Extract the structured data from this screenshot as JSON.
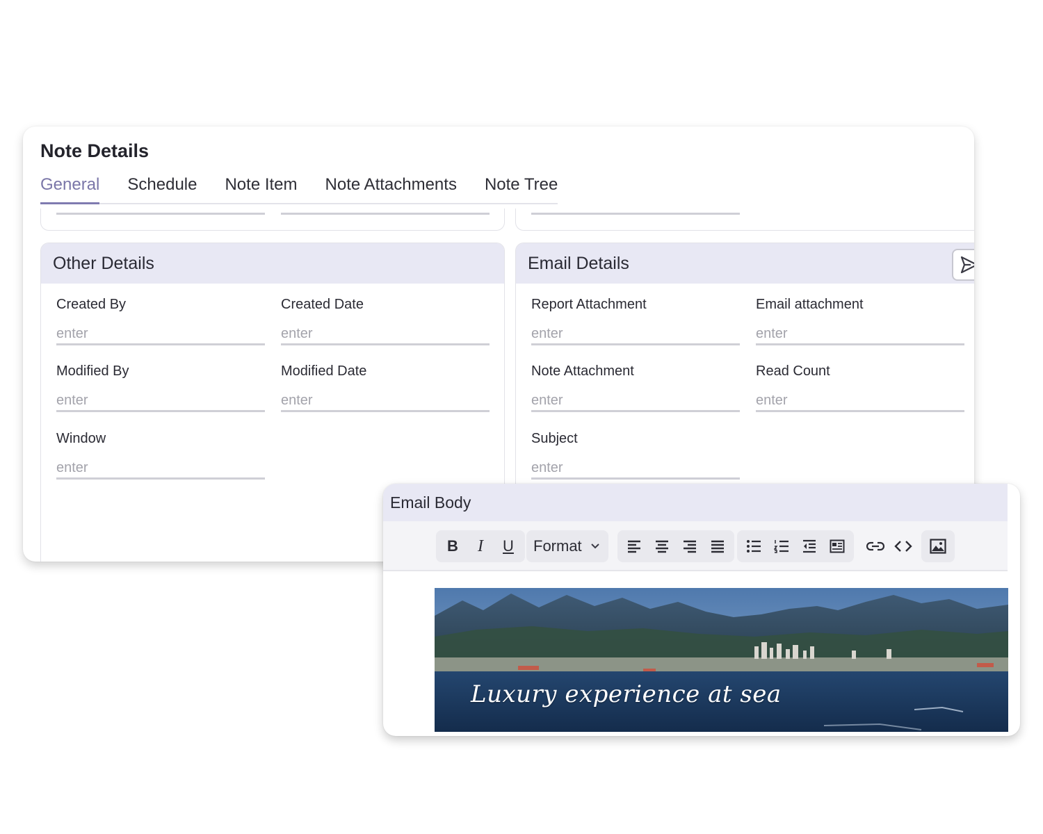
{
  "page_title": "Note Details",
  "tabs": [
    {
      "label": "General",
      "active": true
    },
    {
      "label": "Schedule",
      "active": false
    },
    {
      "label": "Note Item",
      "active": false
    },
    {
      "label": "Note Attachments",
      "active": false
    },
    {
      "label": "Note Tree",
      "active": false
    }
  ],
  "other_details": {
    "title": "Other Details",
    "fields": [
      {
        "label": "Created By",
        "placeholder": "enter"
      },
      {
        "label": "Created Date",
        "placeholder": "enter"
      },
      {
        "label": "Modified By",
        "placeholder": "enter"
      },
      {
        "label": "Modified Date",
        "placeholder": "enter"
      },
      {
        "label": "Window",
        "placeholder": "enter"
      }
    ]
  },
  "email_details": {
    "title": "Email Details",
    "send_icon": "send-icon",
    "fields": [
      {
        "label": "Report Attachment",
        "placeholder": "enter"
      },
      {
        "label": "Email attachment",
        "placeholder": "enter"
      },
      {
        "label": "Note Attachment",
        "placeholder": "enter"
      },
      {
        "label": "Read Count",
        "placeholder": "enter"
      },
      {
        "label": "Subject",
        "placeholder": "enter"
      }
    ]
  },
  "email_body": {
    "title": "Email Body",
    "toolbar": {
      "bold": "B",
      "italic": "I",
      "underline": "U",
      "format_label": "Format",
      "icons": [
        "align-left-icon",
        "align-center-icon",
        "align-right-icon",
        "align-justify-icon",
        "bullet-list-icon",
        "numbered-list-icon",
        "outdent-icon",
        "indent-icon",
        "link-icon",
        "code-icon",
        "image-icon"
      ]
    },
    "image_caption": "Luxury experience at sea"
  },
  "colors": {
    "accent": "#7a76a8",
    "header_bg": "#e8e8f4",
    "divider": "#cfcfd6"
  }
}
